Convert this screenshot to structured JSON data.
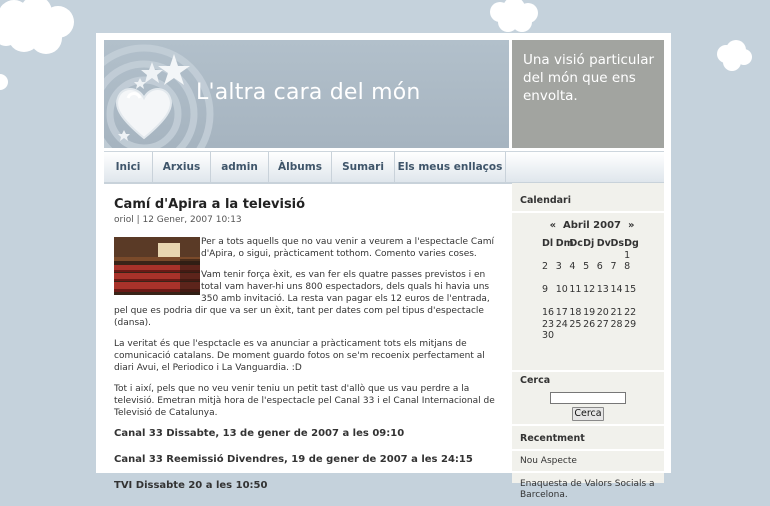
{
  "blog": {
    "title": "L'altra cara del món",
    "tagline": "Una visió particular del món que ens envolta."
  },
  "nav": {
    "items": [
      "Inici",
      "Arxius",
      "admin",
      "Àlbums",
      "Sumari",
      "Els meus enllaços"
    ]
  },
  "post": {
    "title": "Camí d'Apira a la televisió",
    "meta": "oriol | 12 Gener, 2007 10:13",
    "paragraphs": [
      "Per a tots aquells que no vau venir a veurem a l'espectacle Camí d'Apira, o sigui, pràcticament tothom. Comento varies coses.",
      "Vam tenir força èxit, es van fer els quatre passes previstos i en total vam haver-hi uns 800 espectadors, dels quals hi havia uns 350 amb invitació. La resta van pagar els 12 euros de l'entrada, pel que es podria dir que va ser un èxit, tant per dates com pel tipus d'espectacle (dansa).",
      "La veritat és que l'espctacle es va anunciar a pràcticament tots els mitjans de comunicació catalans. De moment guardo fotos on se'm recoenix perfectament al diari Avui, el Periodico i La Vanguardia. :D",
      "Tot i així, pels que no veu venir teniu un petit tast d'allò que us vau perdre a la televisió. Emetran mitjà hora de l'espectacle pel Canal 33 i el Canal Internacional de Televisió de Catalunya."
    ],
    "schedule": [
      "Canal 33 Dissabte, 13 de gener de 2007 a les 09:10",
      "Canal 33 Reemissió Divendres, 19 de gener de 2007 a les 24:15",
      "TVI Dissabte 20 a les 10:50"
    ]
  },
  "sidebar": {
    "calendar": {
      "heading": "Calendari",
      "prev": "«",
      "month": "Abril 2007",
      "next": "»",
      "weekdays": [
        "Dl",
        "Dm",
        "Dc",
        "Dj",
        "Dv",
        "Ds",
        "Dg"
      ],
      "first_weekday_index": 6,
      "days": 30,
      "blank_rows_after": [
        8,
        15
      ]
    },
    "search": {
      "heading": "Cerca",
      "value": "",
      "button": "Cerca"
    },
    "recent": {
      "heading": "Recentment",
      "items": [
        "Nou Aspecte",
        "Enaquesta de Valors Socials a Barcelona."
      ]
    }
  },
  "colors": {
    "background": "#c5d2dc",
    "header": "#a6b4c0",
    "tagline_box": "#a2a4a0",
    "nav_text": "#3f556a",
    "sidebar": "#f1f1ec"
  }
}
